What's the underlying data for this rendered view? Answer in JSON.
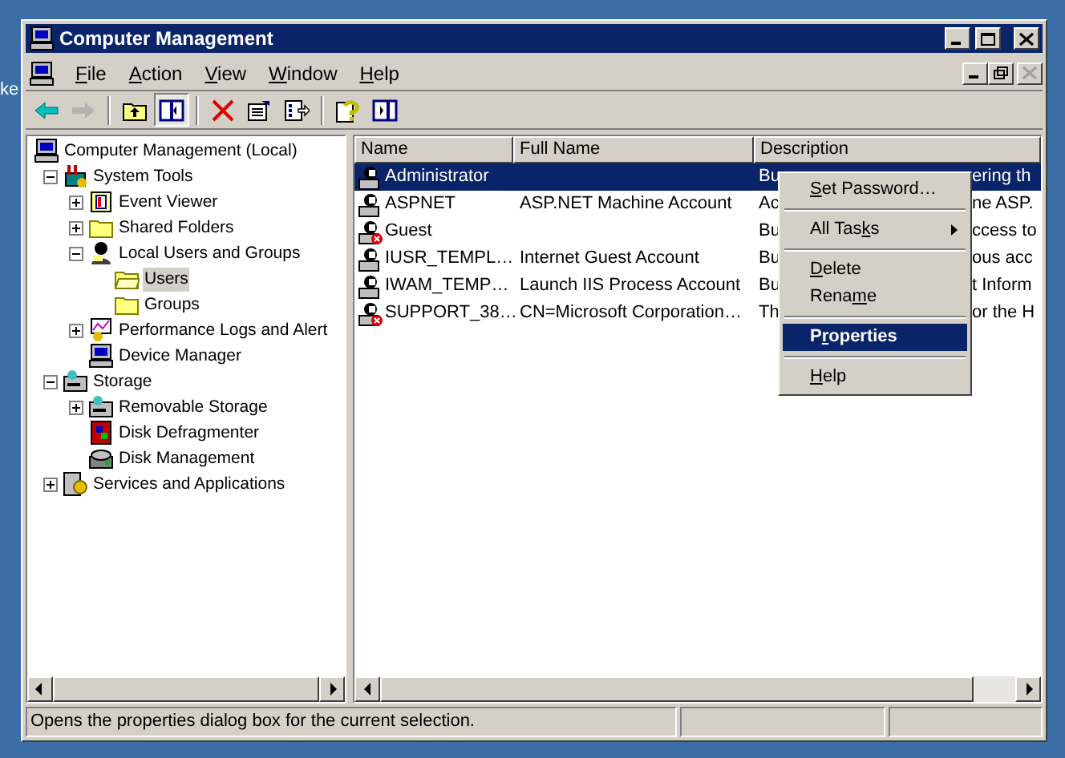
{
  "desktop_label": "ke",
  "window": {
    "title": "Computer Management"
  },
  "menubar": [
    {
      "parts": {
        "key": "F",
        "after": "ile"
      }
    },
    {
      "parts": {
        "key": "A",
        "after": "ction"
      }
    },
    {
      "parts": {
        "key": "V",
        "after": "iew"
      }
    },
    {
      "parts": {
        "key": "W",
        "after": "indow"
      }
    },
    {
      "parts": {
        "key": "H",
        "after": "elp"
      }
    }
  ],
  "toolbar": [
    {
      "kind": "back",
      "disabled": false,
      "pressed": false
    },
    {
      "kind": "forward",
      "disabled": true,
      "pressed": false
    },
    {
      "kind": "sep"
    },
    {
      "kind": "up",
      "disabled": false,
      "pressed": false
    },
    {
      "kind": "tree",
      "disabled": false,
      "pressed": true
    },
    {
      "kind": "sep"
    },
    {
      "kind": "delete",
      "disabled": false,
      "pressed": false
    },
    {
      "kind": "properties",
      "disabled": false,
      "pressed": false
    },
    {
      "kind": "export",
      "disabled": false,
      "pressed": false
    },
    {
      "kind": "sep"
    },
    {
      "kind": "help",
      "disabled": false,
      "pressed": false
    },
    {
      "kind": "actionpane",
      "disabled": false,
      "pressed": false
    }
  ],
  "tree": [
    {
      "label": "Computer Management (Local)",
      "kind": "computer",
      "selected": false,
      "children": [
        {
          "label": "System Tools",
          "kind": "tools",
          "selected": false,
          "expanded": true,
          "children": [
            {
              "label": "Event Viewer",
              "kind": "log",
              "selected": false,
              "expanded": false
            },
            {
              "label": "Shared Folders",
              "kind": "folder",
              "selected": false,
              "expanded": false
            },
            {
              "label": "Local Users and Groups",
              "kind": "users",
              "selected": false,
              "expanded": true,
              "children": [
                {
                  "label": "Users",
                  "kind": "openfolder",
                  "selected": true
                },
                {
                  "label": "Groups",
                  "kind": "folder",
                  "selected": false
                }
              ]
            },
            {
              "label": "Performance Logs and Alert",
              "kind": "chart",
              "selected": false,
              "expanded": false
            },
            {
              "label": "Device Manager",
              "kind": "device",
              "selected": false
            }
          ]
        },
        {
          "label": "Storage",
          "kind": "storage",
          "selected": false,
          "expanded": true,
          "children": [
            {
              "label": "Removable Storage",
              "kind": "removable",
              "selected": false,
              "expanded": false
            },
            {
              "label": "Disk Defragmenter",
              "kind": "defrag",
              "selected": false
            },
            {
              "label": "Disk Management",
              "kind": "disk",
              "selected": false
            }
          ]
        },
        {
          "label": "Services and Applications",
          "kind": "services",
          "selected": false,
          "expanded": false
        }
      ]
    }
  ],
  "table": {
    "columns": [
      "Name",
      "Full Name",
      "Description"
    ],
    "rows": [
      {
        "name": "Administrator",
        "description_start": "Bu",
        "description_end": "ering th",
        "selected": true,
        "disabled": false
      },
      {
        "name": "ASPNET",
        "full_name": "ASP.NET Machine Account",
        "description_start": "Ac",
        "description_end": "ne ASP.",
        "selected": false,
        "disabled": false
      },
      {
        "name": "Guest",
        "description_start": "Bu",
        "description_end": "ccess to",
        "selected": false,
        "disabled": true
      },
      {
        "name": "IUSR_TEMPL…",
        "full_name": "Internet Guest Account",
        "description_start": "Bu",
        "description_end": "ous acc",
        "selected": false,
        "disabled": false
      },
      {
        "name": "IWAM_TEMP…",
        "full_name": "Launch IIS Process Account",
        "description_start": "Bu",
        "description_end": "t Inform",
        "selected": false,
        "disabled": false
      },
      {
        "name": "SUPPORT_38…",
        "full_name": "CN=Microsoft Corporation…",
        "description_start": "Th",
        "description_end": "or the H",
        "selected": false,
        "disabled": true
      }
    ]
  },
  "context_menu": [
    {
      "kind": "item",
      "parts": {
        "key": "S",
        "after": "et Password…"
      },
      "selected": false,
      "submenu": false
    },
    {
      "kind": "separator"
    },
    {
      "kind": "item",
      "parts": {
        "before": "All Tas",
        "key": "k",
        "after": "s"
      },
      "selected": false,
      "submenu": true
    },
    {
      "kind": "separator"
    },
    {
      "kind": "item",
      "parts": {
        "key": "D",
        "after": "elete"
      },
      "selected": false,
      "submenu": false
    },
    {
      "kind": "item",
      "parts": {
        "before": "Rena",
        "key": "m",
        "after": "e"
      },
      "selected": false,
      "submenu": false
    },
    {
      "kind": "separator"
    },
    {
      "kind": "item",
      "parts": {
        "before": "P",
        "key": "r",
        "after": "operties"
      },
      "selected": true,
      "default": true,
      "submenu": false
    },
    {
      "kind": "separator"
    },
    {
      "kind": "item",
      "parts": {
        "key": "H",
        "after": "elp"
      },
      "selected": false,
      "submenu": false
    }
  ],
  "status_bar": {
    "text": "Opens the properties dialog box for the current selection."
  }
}
